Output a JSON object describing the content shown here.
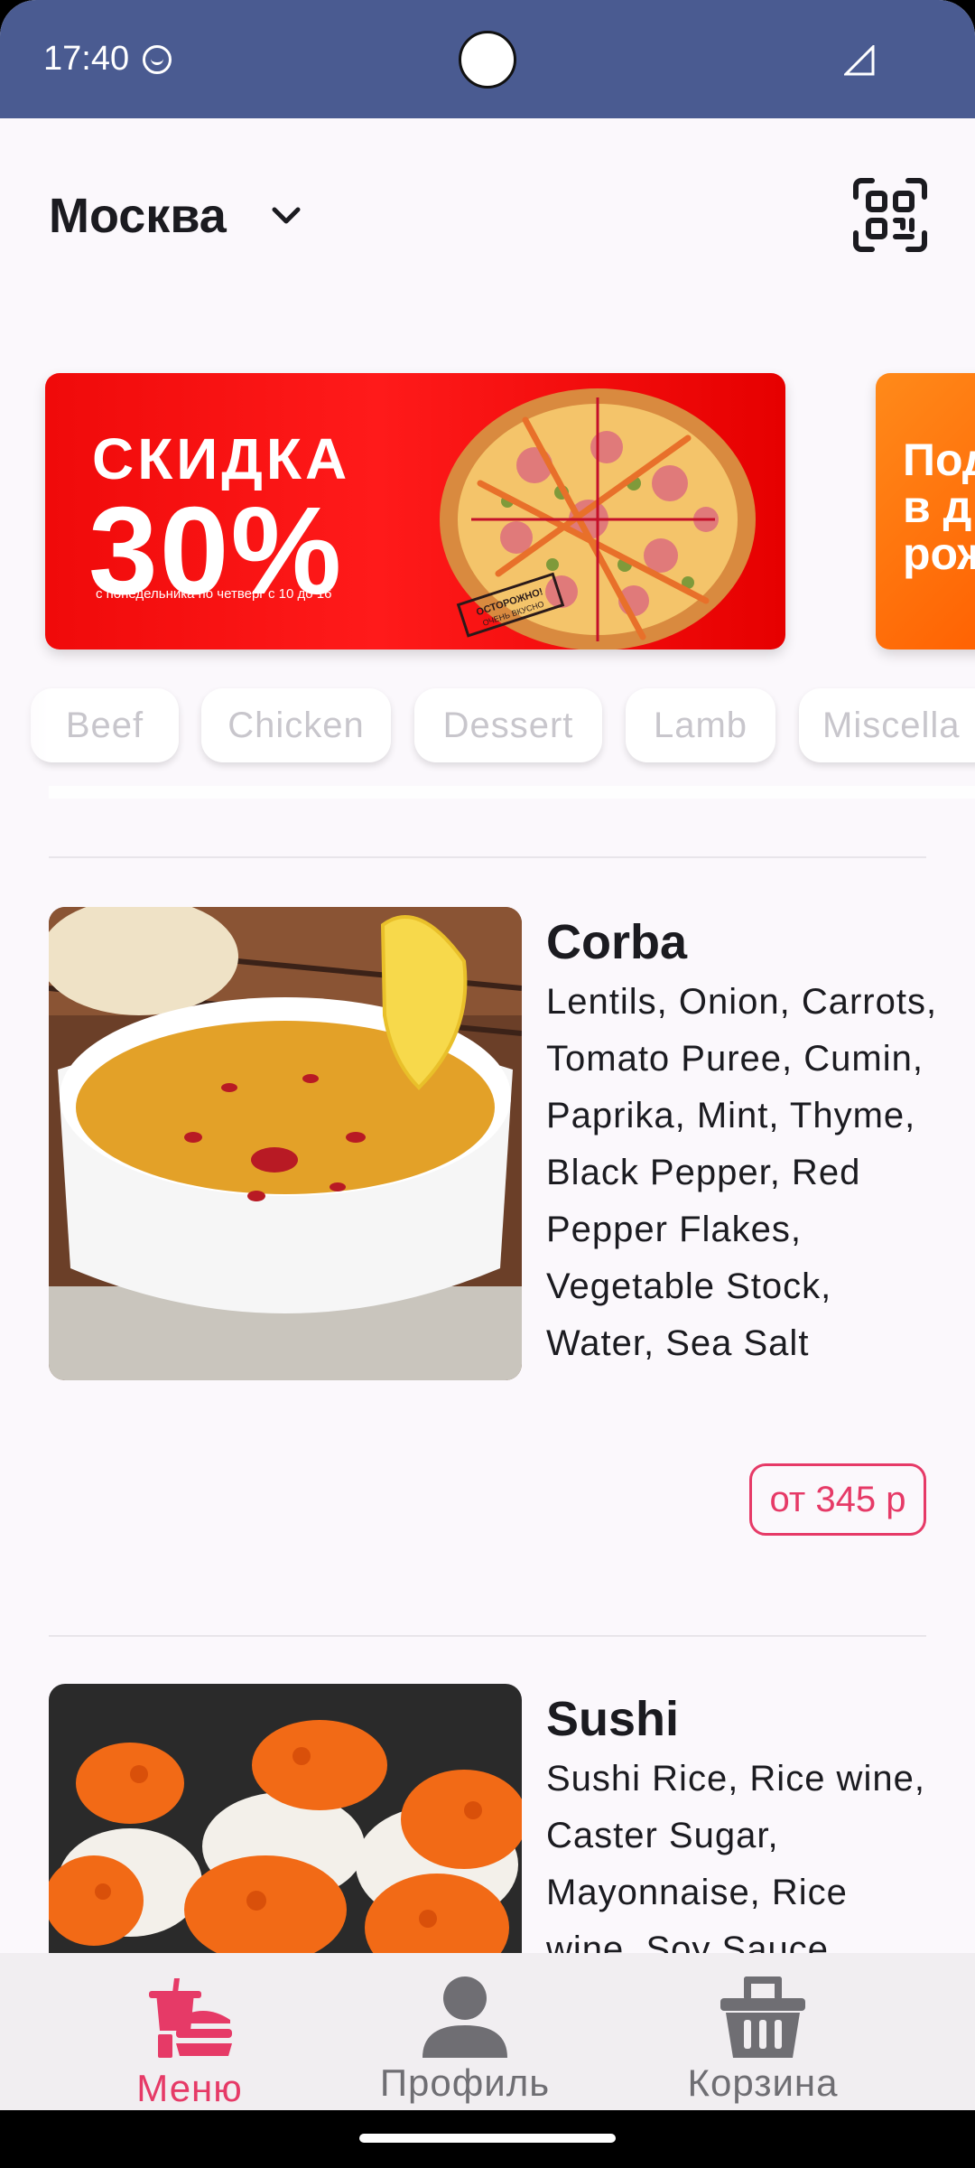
{
  "status_bar": {
    "time": "17:40"
  },
  "header": {
    "city": "Москва"
  },
  "banners": [
    {
      "title": "СКИДКА",
      "percent": "30%",
      "caption": "с понедельника по четверг с 10 до 16",
      "stamp": "ОСТОРОЖНО! ОЧЕНЬ ВКУСНО"
    },
    {
      "text": "Под\nв д\nрож"
    }
  ],
  "categories": [
    "Beef",
    "Chicken",
    "Dessert",
    "Lamb",
    "Miscella"
  ],
  "menu": [
    {
      "name": "Corba",
      "description": "Lentils, Onion, Carrots, Tomato Puree, Cumin, Paprika, Mint, Thyme, Black Pepper, Red Pepper Flakes, Vegetable Stock, Water, Sea Salt",
      "price": "от 345 р"
    },
    {
      "name": "Sushi",
      "description": "Sushi Rice, Rice wine, Caster Sugar, Mayonnaise, Rice wine, Soy Sauce"
    }
  ],
  "nav": [
    {
      "label": "Меню",
      "icon": "food-icon",
      "active": true
    },
    {
      "label": "Профиль",
      "icon": "profile-icon",
      "active": false
    },
    {
      "label": "Корзина",
      "icon": "basket-icon",
      "active": false
    }
  ],
  "colors": {
    "status_bar": "#4a5b91",
    "accent": "#e63a67",
    "banner_red": "#f00a0a",
    "inactive": "#6f6e73"
  }
}
